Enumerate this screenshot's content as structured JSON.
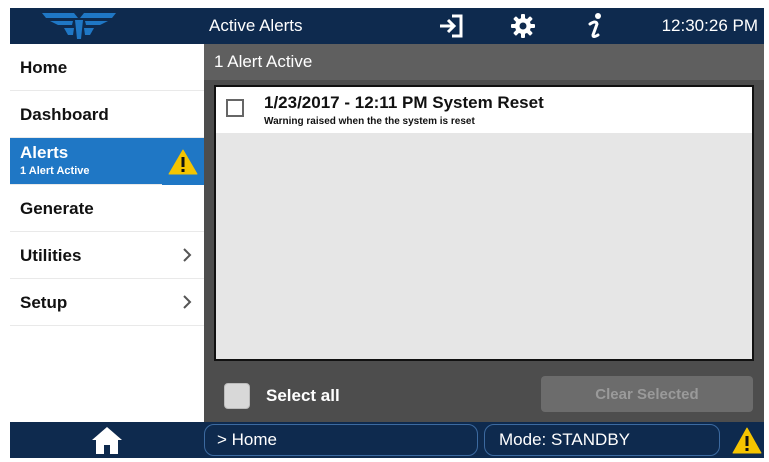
{
  "header": {
    "title": "Active Alerts",
    "time": "12:30:26 PM",
    "icons": [
      "logout-icon",
      "gear-icon",
      "info-icon"
    ]
  },
  "sidebar": {
    "items": [
      {
        "label": "Home"
      },
      {
        "label": "Dashboard"
      },
      {
        "label": "Alerts",
        "sub": "1 Alert Active",
        "active": true
      },
      {
        "label": "Generate"
      },
      {
        "label": "Utilities",
        "chevron": true
      },
      {
        "label": "Setup",
        "chevron": true
      }
    ]
  },
  "main": {
    "banner": "1 Alert Active",
    "alerts": [
      {
        "title": "1/23/2017 - 12:11 PM System Reset",
        "description": "Warning raised when the the system is reset",
        "checked": false
      }
    ],
    "select_all_label": "Select all",
    "clear_button_label": "Clear Selected"
  },
  "footer": {
    "breadcrumb": "> Home",
    "mode": "Mode: STANDBY"
  },
  "colors": {
    "navy": "#0e2a4e",
    "accent_blue": "#1f77c5",
    "warning_yellow": "#f5c400",
    "panel_dark": "#4d4d4d"
  }
}
